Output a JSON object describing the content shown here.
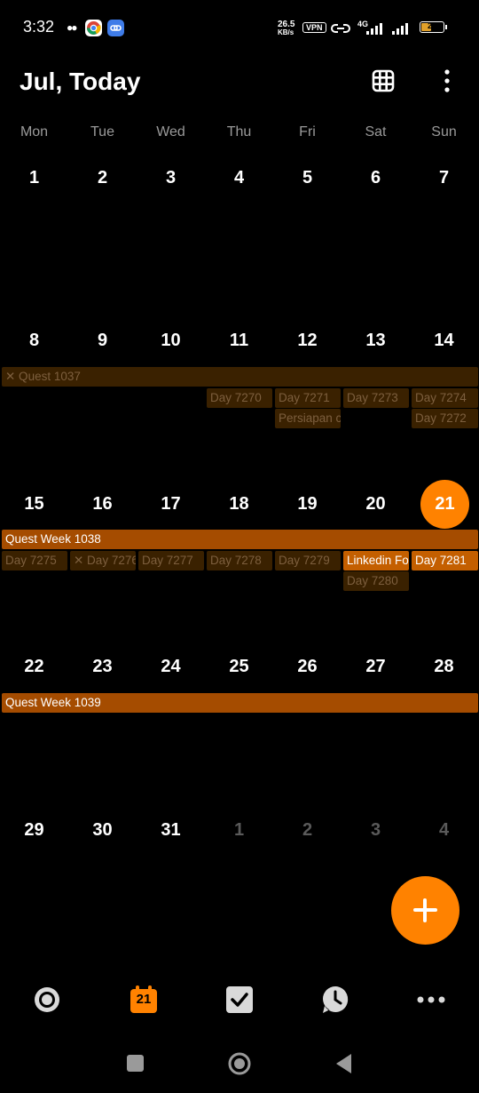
{
  "status_bar": {
    "time": "3:32",
    "net_speed_value": "26.5",
    "net_speed_unit": "KB/s",
    "vpn": "VPN",
    "network": "4G",
    "battery": "27"
  },
  "header": {
    "title": "Jul, Today"
  },
  "weekdays": [
    "Mon",
    "Tue",
    "Wed",
    "Thu",
    "Fri",
    "Sat",
    "Sun"
  ],
  "weeks": [
    [
      "1",
      "2",
      "3",
      "4",
      "5",
      "6",
      "7"
    ],
    [
      "8",
      "9",
      "10",
      "11",
      "12",
      "13",
      "14"
    ],
    [
      "15",
      "16",
      "17",
      "18",
      "19",
      "20",
      "21"
    ],
    [
      "22",
      "23",
      "24",
      "25",
      "26",
      "27",
      "28"
    ],
    [
      "29",
      "30",
      "31",
      "1",
      "2",
      "3",
      "4"
    ]
  ],
  "today": "21",
  "events": {
    "week2": {
      "quest": "✕ Quest 1037",
      "day7270": "Day 7270",
      "day7271": "Day 7271",
      "day7273": "Day 7273",
      "day7274": "Day 7274",
      "persiapan": "Persiapan c",
      "day7272": "Day 7272"
    },
    "week3": {
      "quest": "Quest Week 1038",
      "day7275": "Day 7275",
      "day7276": "✕ Day 7276",
      "day7277": "Day 7277",
      "day7278": "Day 7278",
      "day7279": "Day 7279",
      "linkedin": "Linkedin Fo",
      "day7281": "Day 7281",
      "day7280": "Day 7280"
    },
    "week4": {
      "quest": "Quest Week 1039"
    }
  },
  "bottom_nav": {
    "calendar_day": "21"
  },
  "colors": {
    "accent": "#ff8200",
    "event_dim": "#3a2100",
    "event_week": "#a54c00",
    "event_bright": "#c45f00"
  }
}
